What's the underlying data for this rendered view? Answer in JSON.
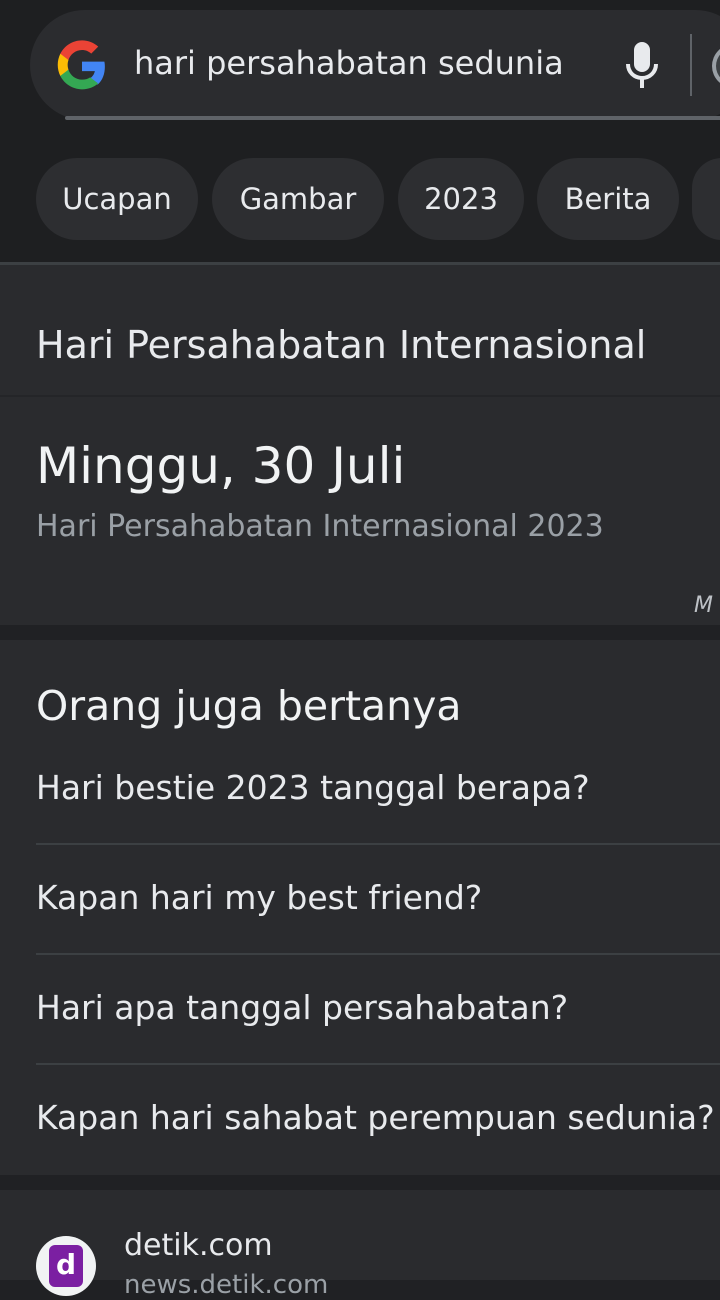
{
  "search": {
    "query": "hari persahabatan sedunia"
  },
  "chips": [
    "Ucapan",
    "Gambar",
    "2023",
    "Berita"
  ],
  "featured": {
    "title": "Hari Persahabatan Internasional",
    "date": "Minggu, 30 Juli",
    "subtitle": "Hari Persahabatan Internasional 2023",
    "more_label_partial": "M"
  },
  "people_also_ask": {
    "title": "Orang juga bertanya",
    "questions": [
      "Hari bestie 2023 tanggal berapa?",
      "Kapan hari my best friend?",
      "Hari apa tanggal persahabatan?",
      "Kapan hari sahabat perempuan sedunia?"
    ]
  },
  "result": {
    "site": "detik.com",
    "favicon_letter": "d",
    "sub_partial": "news.detik.com"
  }
}
